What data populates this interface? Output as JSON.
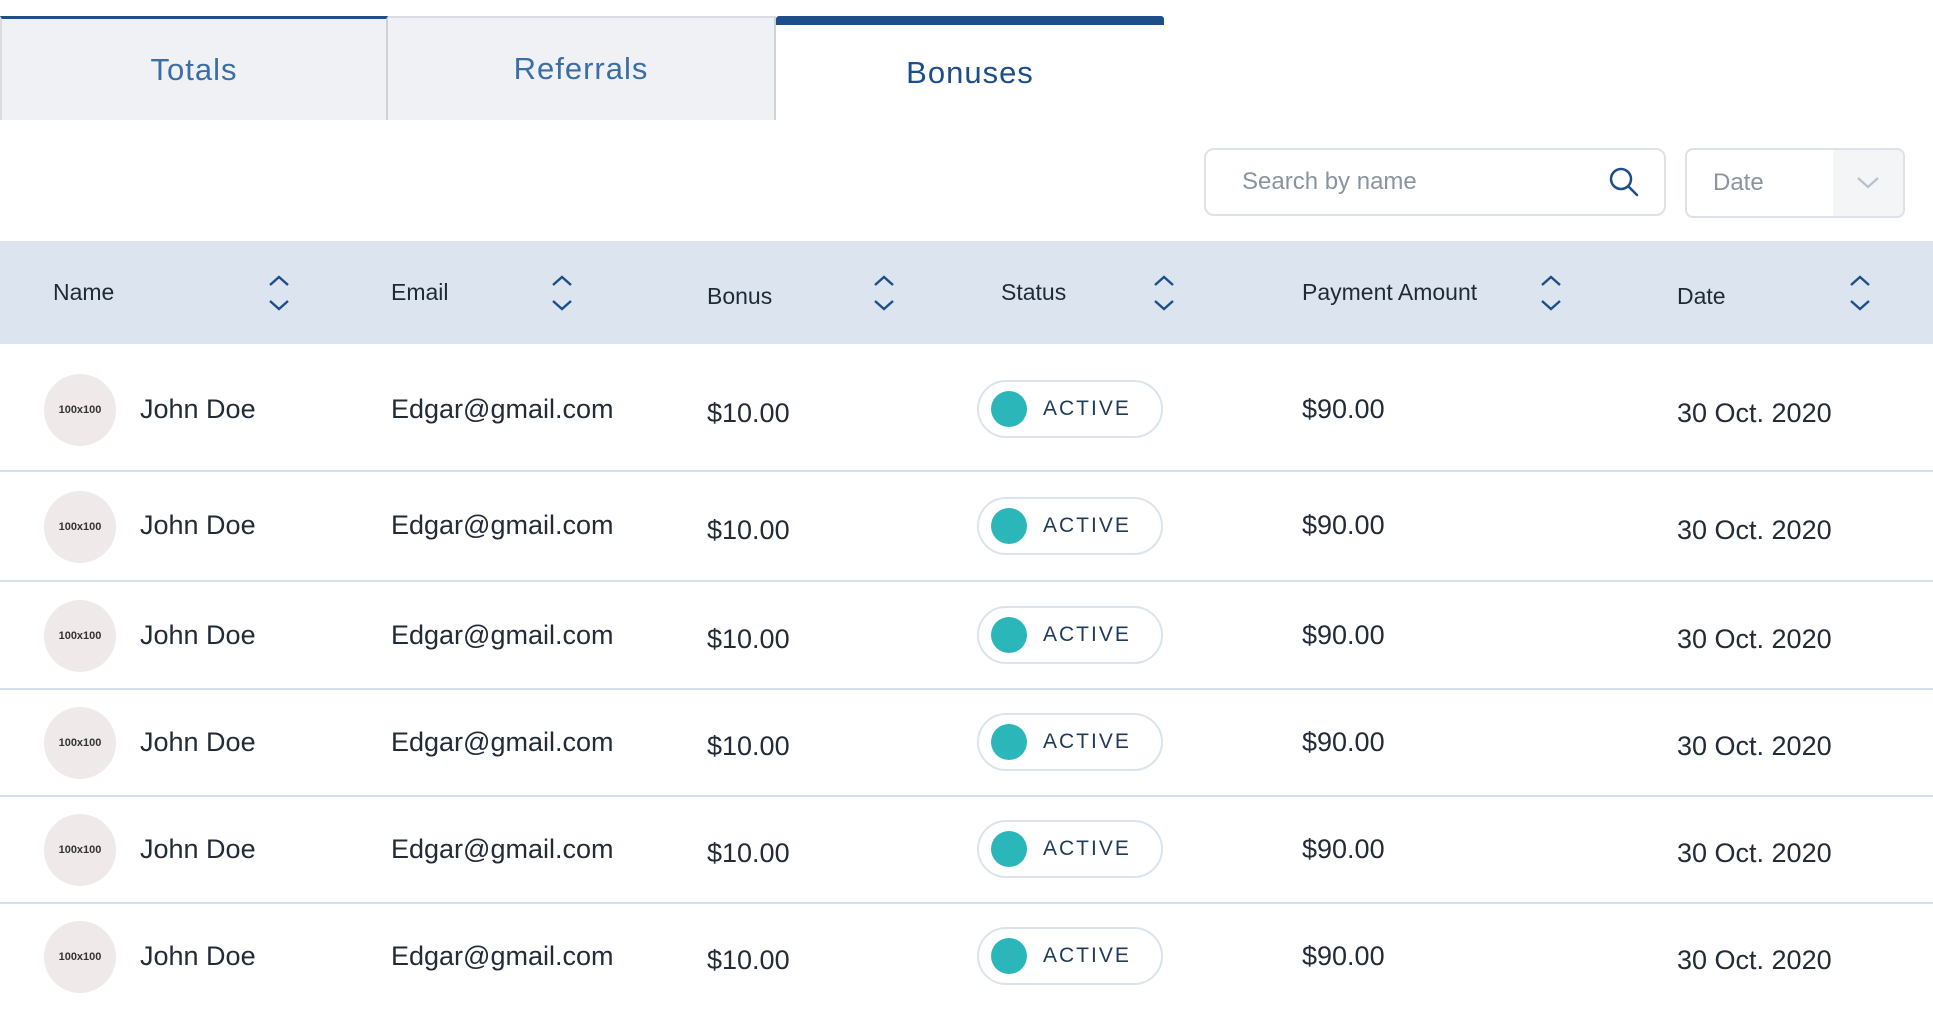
{
  "tabs": [
    {
      "label": "Totals"
    },
    {
      "label": "Referrals"
    },
    {
      "label": "Bonuses"
    }
  ],
  "search": {
    "placeholder": "Search by name"
  },
  "date_filter": {
    "value": "Date"
  },
  "columns": {
    "name": "Name",
    "email": "Email",
    "bonus": "Bonus",
    "status": "Status",
    "payment": "Payment Amount",
    "date": "Date"
  },
  "rows": [
    {
      "avatar": "100x100",
      "name": "John Doe",
      "email": "Edgar@gmail.com",
      "bonus": "$10.00",
      "status": "ACTIVE",
      "payment": "$90.00",
      "date": "30 Oct. 2020"
    },
    {
      "avatar": "100x100",
      "name": "John Doe",
      "email": "Edgar@gmail.com",
      "bonus": "$10.00",
      "status": "ACTIVE",
      "payment": "$90.00",
      "date": "30 Oct. 2020"
    },
    {
      "avatar": "100x100",
      "name": "John Doe",
      "email": "Edgar@gmail.com",
      "bonus": "$10.00",
      "status": "ACTIVE",
      "payment": "$90.00",
      "date": "30 Oct. 2020"
    },
    {
      "avatar": "100x100",
      "name": "John Doe",
      "email": "Edgar@gmail.com",
      "bonus": "$10.00",
      "status": "ACTIVE",
      "payment": "$90.00",
      "date": "30 Oct. 2020"
    },
    {
      "avatar": "100x100",
      "name": "John Doe",
      "email": "Edgar@gmail.com",
      "bonus": "$10.00",
      "status": "ACTIVE",
      "payment": "$90.00",
      "date": "30 Oct. 2020"
    },
    {
      "avatar": "100x100",
      "name": "John Doe",
      "email": "Edgar@gmail.com",
      "bonus": "$10.00",
      "status": "ACTIVE",
      "payment": "$90.00",
      "date": "30 Oct. 2020"
    }
  ],
  "colors": {
    "accent": "#1d4e89",
    "header_bg": "#dce4ef",
    "status_active": "#2bb6b9"
  }
}
